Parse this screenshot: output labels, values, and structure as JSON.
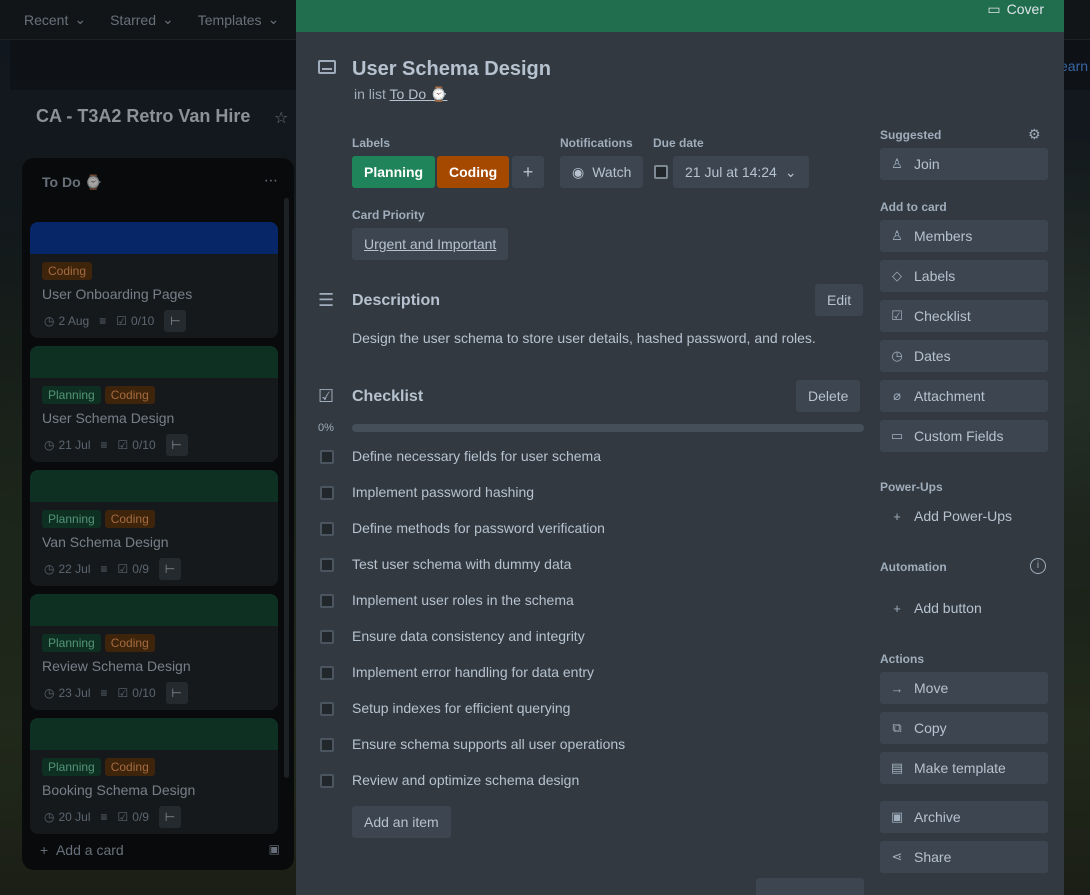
{
  "topnav": {
    "items": [
      {
        "label": "Recent"
      },
      {
        "label": "Starred"
      },
      {
        "label": "Templates"
      }
    ],
    "right_text": "earn"
  },
  "board": {
    "title": "CA - T3A2 Retro Van Hire"
  },
  "list": {
    "title": "To Do ⌚",
    "add_card": "Add a card",
    "cards": [
      {
        "cover": "#0c3b9e",
        "labels": [
          {
            "text": "Coding",
            "color": "orange"
          }
        ],
        "title": "User Onboarding Pages",
        "date": "2 Aug",
        "checklist": "0/10"
      },
      {
        "cover": "#164b35",
        "labels": [
          {
            "text": "Planning",
            "color": "green"
          },
          {
            "text": "Coding",
            "color": "orange"
          }
        ],
        "title": "User Schema Design",
        "date": "21 Jul",
        "checklist": "0/10"
      },
      {
        "cover": "#164b35",
        "labels": [
          {
            "text": "Planning",
            "color": "green"
          },
          {
            "text": "Coding",
            "color": "orange"
          }
        ],
        "title": "Van Schema Design",
        "date": "22 Jul",
        "checklist": "0/9"
      },
      {
        "cover": "#164b35",
        "labels": [
          {
            "text": "Planning",
            "color": "green"
          },
          {
            "text": "Coding",
            "color": "orange"
          }
        ],
        "title": "Review Schema Design",
        "date": "23 Jul",
        "checklist": "0/10"
      },
      {
        "cover": "#164b35",
        "labels": [
          {
            "text": "Planning",
            "color": "green"
          },
          {
            "text": "Coding",
            "color": "orange"
          }
        ],
        "title": "Booking Schema Design",
        "date": "20 Jul",
        "checklist": "0/9"
      }
    ]
  },
  "modal": {
    "cover_label": "Cover",
    "title": "User Schema Design",
    "in_list_prefix": "in list",
    "in_list_name": "To Do ⌚",
    "labels_heading": "Labels",
    "labels": [
      {
        "text": "Planning"
      },
      {
        "text": "Coding"
      }
    ],
    "notifications_heading": "Notifications",
    "watch_label": "Watch",
    "due_heading": "Due date",
    "due_value": "21 Jul at 14:24",
    "priority_heading": "Card Priority",
    "priority_value": "Urgent and Important",
    "description_heading": "Description",
    "edit_label": "Edit",
    "description": "Design the user schema to store user details, hashed password, and roles.",
    "checklist_heading": "Checklist",
    "delete_label": "Delete",
    "progress_percent": "0%",
    "progress_value": 0,
    "checklist_items": [
      "Define necessary fields for user schema",
      "Implement password hashing",
      "Define methods for password verification",
      "Test user schema with dummy data",
      "Implement user roles in the schema",
      "Ensure data consistency and integrity",
      "Implement error handling for data entry",
      "Setup indexes for efficient querying",
      "Ensure schema supports all user operations",
      "Review and optimize schema design"
    ],
    "add_item_label": "Add an item"
  },
  "sidebar": {
    "suggested_heading": "Suggested",
    "join_label": "Join",
    "add_to_card_heading": "Add to card",
    "add_to_card": [
      "Members",
      "Labels",
      "Checklist",
      "Dates",
      "Attachment",
      "Custom Fields"
    ],
    "powerups_heading": "Power-Ups",
    "add_powerups_label": "Add Power-Ups",
    "automation_heading": "Automation",
    "add_button_label": "Add button",
    "actions_heading": "Actions",
    "actions": [
      "Move",
      "Copy",
      "Make template",
      "Archive",
      "Share"
    ]
  }
}
